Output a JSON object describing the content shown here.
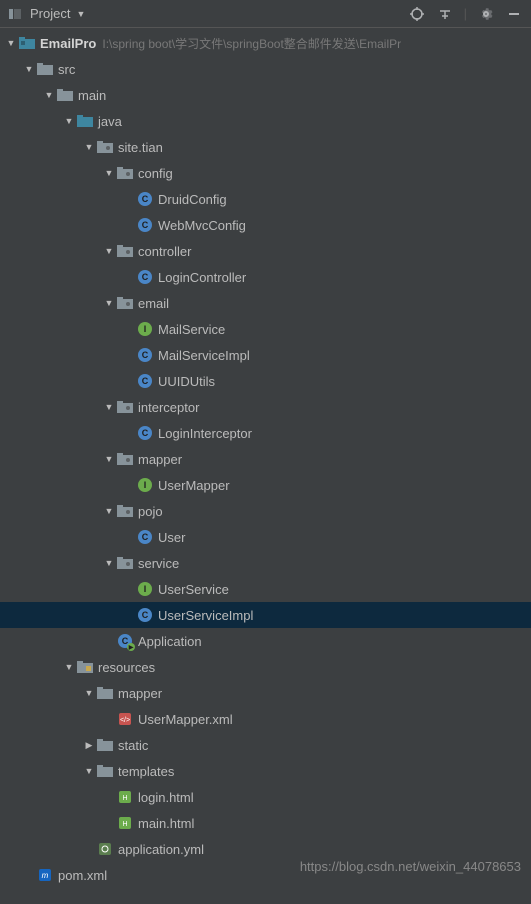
{
  "toolbar": {
    "project_label": "Project"
  },
  "tree": {
    "root": {
      "name": "EmailPro",
      "path": "I:\\spring boot\\学习文件\\springBoot整合邮件发送\\EmailPr"
    },
    "src": "src",
    "main": "main",
    "java": "java",
    "site_tian": "site.tian",
    "config": "config",
    "druid_config": "DruidConfig",
    "webmvc_config": "WebMvcConfig",
    "controller": "controller",
    "login_controller": "LoginController",
    "email": "email",
    "mail_service": "MailService",
    "mail_service_impl": "MailServiceImpl",
    "uuid_utils": "UUIDUtils",
    "interceptor": "interceptor",
    "login_interceptor": "LoginInterceptor",
    "mapper": "mapper",
    "user_mapper": "UserMapper",
    "pojo": "pojo",
    "user": "User",
    "service": "service",
    "user_service": "UserService",
    "user_service_impl": "UserServiceImpl",
    "application": "Application",
    "resources": "resources",
    "resources_mapper": "mapper",
    "user_mapper_xml": "UserMapper.xml",
    "static": "static",
    "templates": "templates",
    "login_html": "login.html",
    "main_html": "main.html",
    "application_yml": "application.yml",
    "pom_xml": "pom.xml"
  },
  "watermark": "https://blog.csdn.net/weixin_44078653"
}
